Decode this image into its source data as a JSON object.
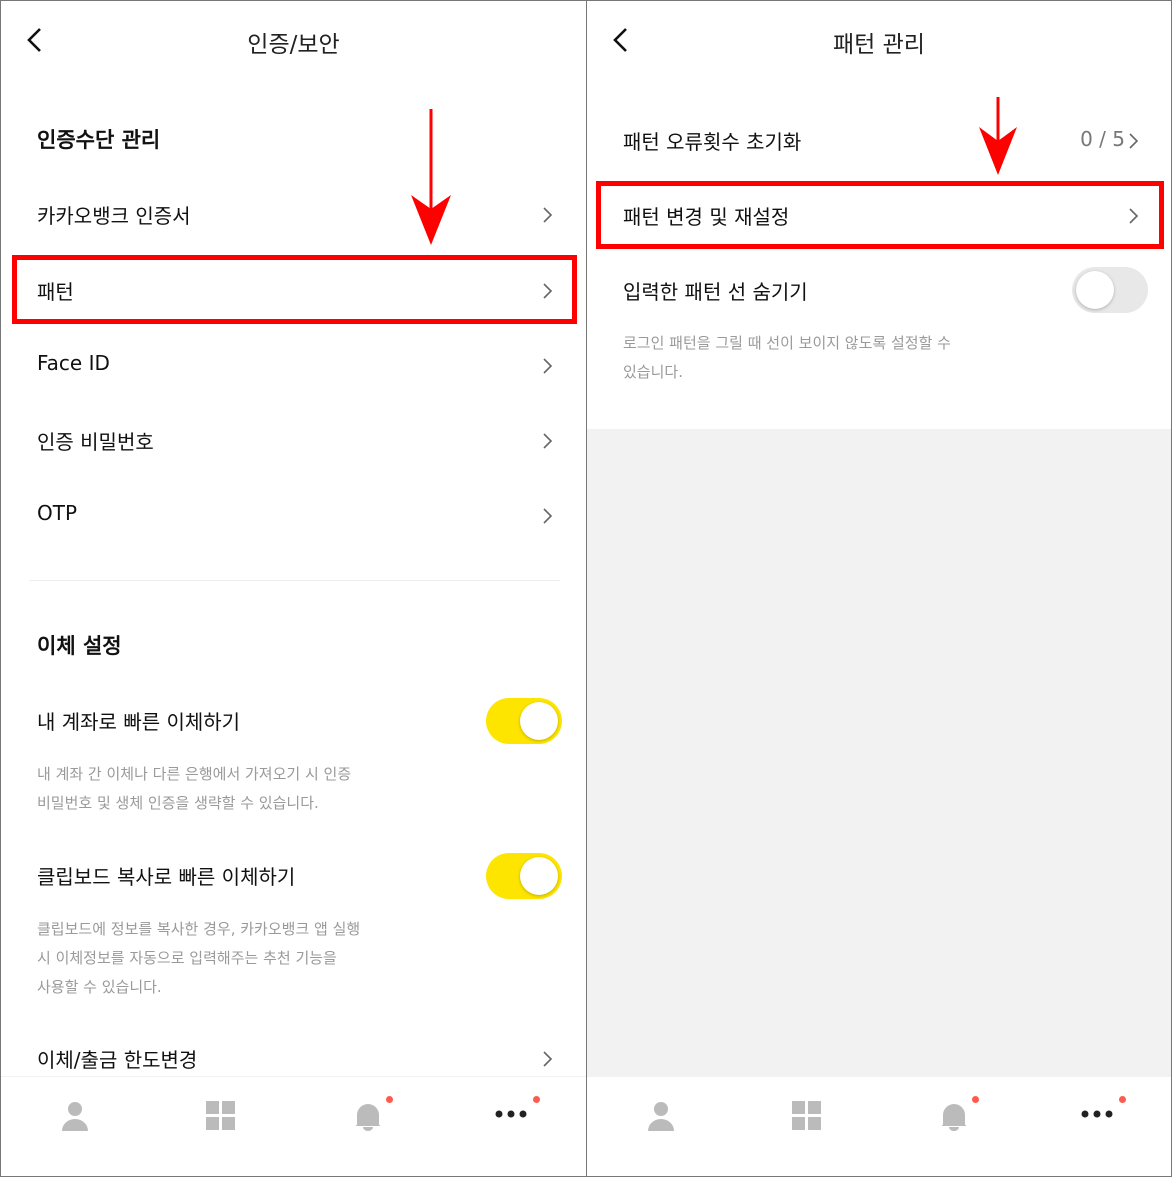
{
  "left": {
    "title": "인증/보안",
    "section1": "인증수단 관리",
    "items": [
      {
        "label": "카카오뱅크 인증서"
      },
      {
        "label": "패턴"
      },
      {
        "label": "Face ID"
      },
      {
        "label": "인증 비밀번호"
      },
      {
        "label": "OTP"
      }
    ],
    "section2": "이체 설정",
    "toggles": [
      {
        "label": "내 계좌로 빠른 이체하기",
        "on": true,
        "desc": [
          "내 계좌 간 이체나 다른 은행에서 가져오기 시 인증",
          "비밀번호 및 생체 인증을 생략할 수 있습니다."
        ]
      },
      {
        "label": "클립보드 복사로 빠른 이체하기",
        "on": true,
        "desc": [
          "클립보드에 정보를 복사한 경우, 카카오뱅크 앱 실행",
          "시 이체정보를 자동으로 입력해주는 추천 기능을",
          "사용할 수 있습니다."
        ]
      }
    ],
    "limit": "이체/출금 한도변경"
  },
  "right": {
    "title": "패턴 관리",
    "reset": {
      "label": "패턴 오류횟수 초기화",
      "value": "0 / 5"
    },
    "change": {
      "label": "패턴 변경 및 재설정"
    },
    "hide": {
      "label": "입력한 패턴 선 숨기기",
      "on": false,
      "desc": [
        "로그인 패턴을 그릴 때 선이 보이지 않도록 설정할 수",
        "있습니다."
      ]
    }
  },
  "tabbar": [
    "person-icon",
    "grid-icon",
    "bell-icon",
    "more-icon"
  ],
  "colors": {
    "accent": "#fee500",
    "highlight": "#ff0000",
    "badge": "#ff5a4f"
  }
}
